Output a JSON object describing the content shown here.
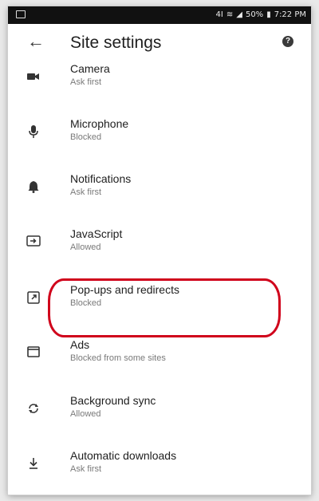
{
  "status_bar": {
    "signal_text": "4I",
    "battery": "50%",
    "time": "7:22 PM"
  },
  "app_bar": {
    "title": "Site settings",
    "back_icon": "arrow-left-icon",
    "help_icon": "help-icon"
  },
  "items": [
    {
      "label": "Camera",
      "sub": "Ask first",
      "icon": "camera-icon"
    },
    {
      "label": "Microphone",
      "sub": "Blocked",
      "icon": "microphone-icon"
    },
    {
      "label": "Notifications",
      "sub": "Ask first",
      "icon": "bell-icon"
    },
    {
      "label": "JavaScript",
      "sub": "Allowed",
      "icon": "javascript-icon"
    },
    {
      "label": "Pop-ups and redirects",
      "sub": "Blocked",
      "icon": "open-in-new-icon"
    },
    {
      "label": "Ads",
      "sub": "Blocked from some sites",
      "icon": "ads-window-icon"
    },
    {
      "label": "Background sync",
      "sub": "Allowed",
      "icon": "sync-icon"
    },
    {
      "label": "Automatic downloads",
      "sub": "Ask first",
      "icon": "download-icon"
    }
  ],
  "highlight_color": "#d0021b"
}
